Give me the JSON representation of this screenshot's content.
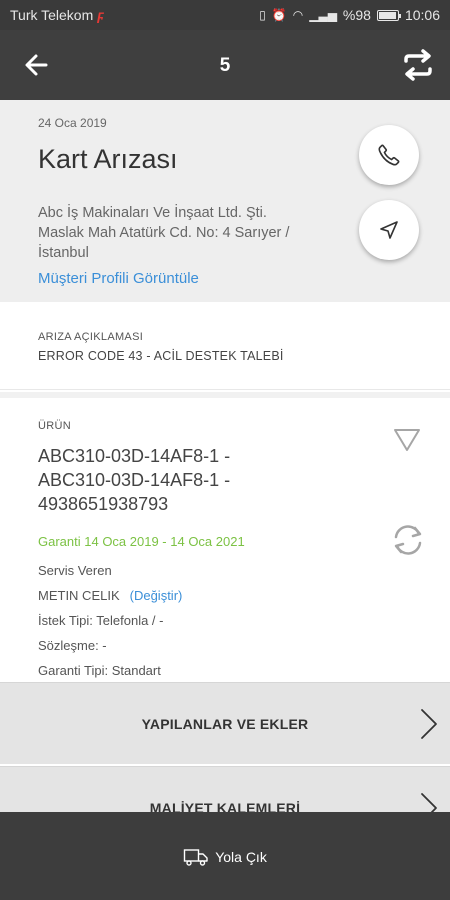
{
  "status_bar": {
    "carrier": "Turk Telekom",
    "battery": "%98",
    "time": "10:06"
  },
  "app_bar": {
    "title": "5"
  },
  "job": {
    "date": "24 Oca 2019",
    "title": "Kart Arızası",
    "company_line1": "Abc İş Makinaları Ve İnşaat Ltd. Şti.",
    "company_line2": "Maslak Mah Atatürk  Cd. No: 4 Sarıyer /",
    "company_line3": "İstanbul",
    "profile_link": "Müşteri Profili Görüntüle"
  },
  "fault": {
    "label": "ARIZA AÇIKLAMASI",
    "value": "ERROR CODE 43 - ACİL DESTEK TALEBİ"
  },
  "product": {
    "label": "ÜRÜN",
    "code_line1": "ABC310-03D-14AF8-1 -",
    "code_line2": "ABC310-03D-14AF8-1 -",
    "code_line3": "4938651938793",
    "warranty": "Garanti 14 Oca 2019 - 14 Oca 2021",
    "service_label": "Servis Veren",
    "technician": "METIN CELIK",
    "change_link": "(Değiştir)",
    "request_type": "İstek Tipi: Telefonla / -",
    "contract": "Sözleşme:  -",
    "warranty_type": "Garanti Tipi: Standart"
  },
  "actions": {
    "row1": "YAPILANLAR VE EKLER",
    "row2": "MALİYET KALEMLERİ"
  },
  "bottom": {
    "button": "Yola Çık"
  },
  "colors": {
    "link": "#3b8fd8",
    "warranty": "#7cc244",
    "appbar": "#3f3f3f"
  }
}
